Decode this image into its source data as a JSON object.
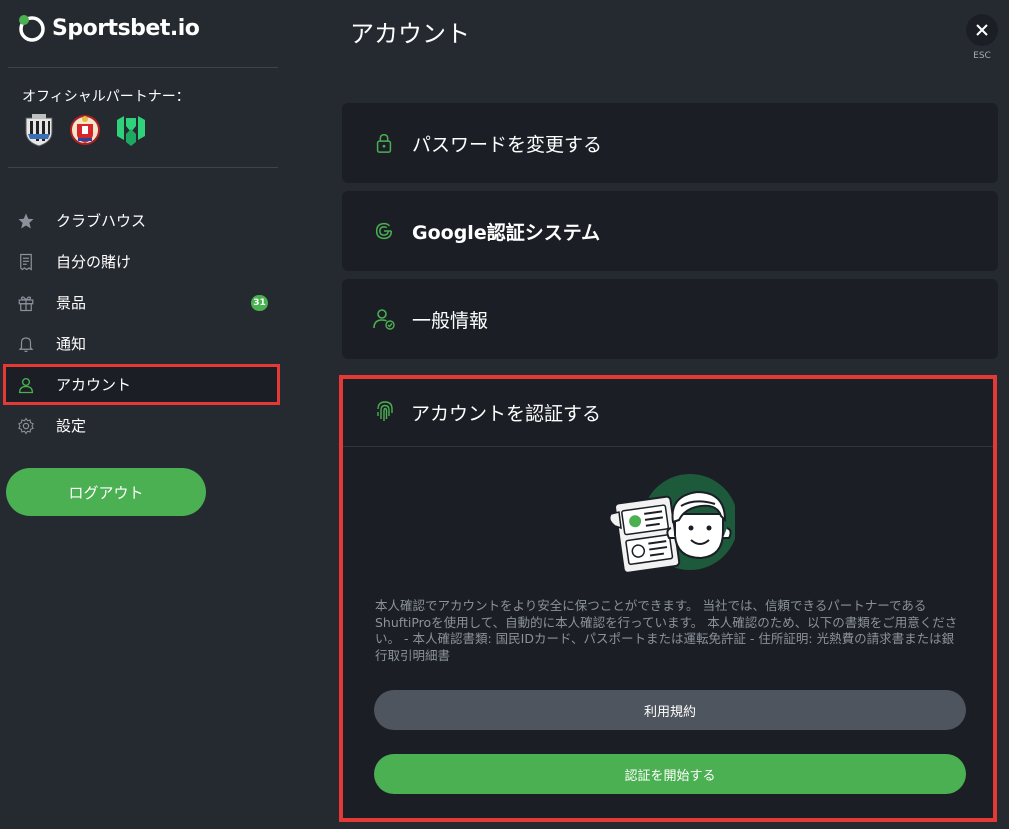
{
  "brand": {
    "name": "Sportsbet.io",
    "accent": "#4bb052",
    "alert": "#e53935"
  },
  "sidebar": {
    "partners_label": "オフィシャルパートナー：",
    "partners": [
      "newcastle-crest",
      "southampton-crest",
      "esports-team-logo"
    ],
    "items": [
      {
        "label": "クラブハウス",
        "icon": "star-icon"
      },
      {
        "label": "自分の賭け",
        "icon": "receipt-icon"
      },
      {
        "label": "景品",
        "icon": "gift-icon",
        "badge": "31"
      },
      {
        "label": "通知",
        "icon": "bell-icon"
      },
      {
        "label": "アカウント",
        "icon": "user-icon",
        "active": true
      },
      {
        "label": "設定",
        "icon": "gear-icon"
      }
    ],
    "logout_label": "ログアウト"
  },
  "main": {
    "title": "アカウント",
    "close_label": "ESC",
    "cards": [
      {
        "label": "パスワードを変更する",
        "icon": "lock-icon"
      },
      {
        "label": "Google認証システム",
        "icon": "google-icon"
      },
      {
        "label": "一般情報",
        "icon": "user-check-icon"
      }
    ],
    "verify": {
      "title": "アカウントを認証する",
      "icon": "fingerprint-icon",
      "description": "本人確認でアカウントをより安全に保つことができます。 当社では、信頼できるパートナーであるShuftiProを使用して、自動的に本人確認を行っています。 本人確認のため、以下の書類をご用意ください。 - 本人確認書類: 国民IDカード、パスポートまたは運転免許証 - 住所証明: 光熱費の請求書または銀行取引明細書",
      "terms_label": "利用規約",
      "start_label": "認証を開始する"
    }
  }
}
